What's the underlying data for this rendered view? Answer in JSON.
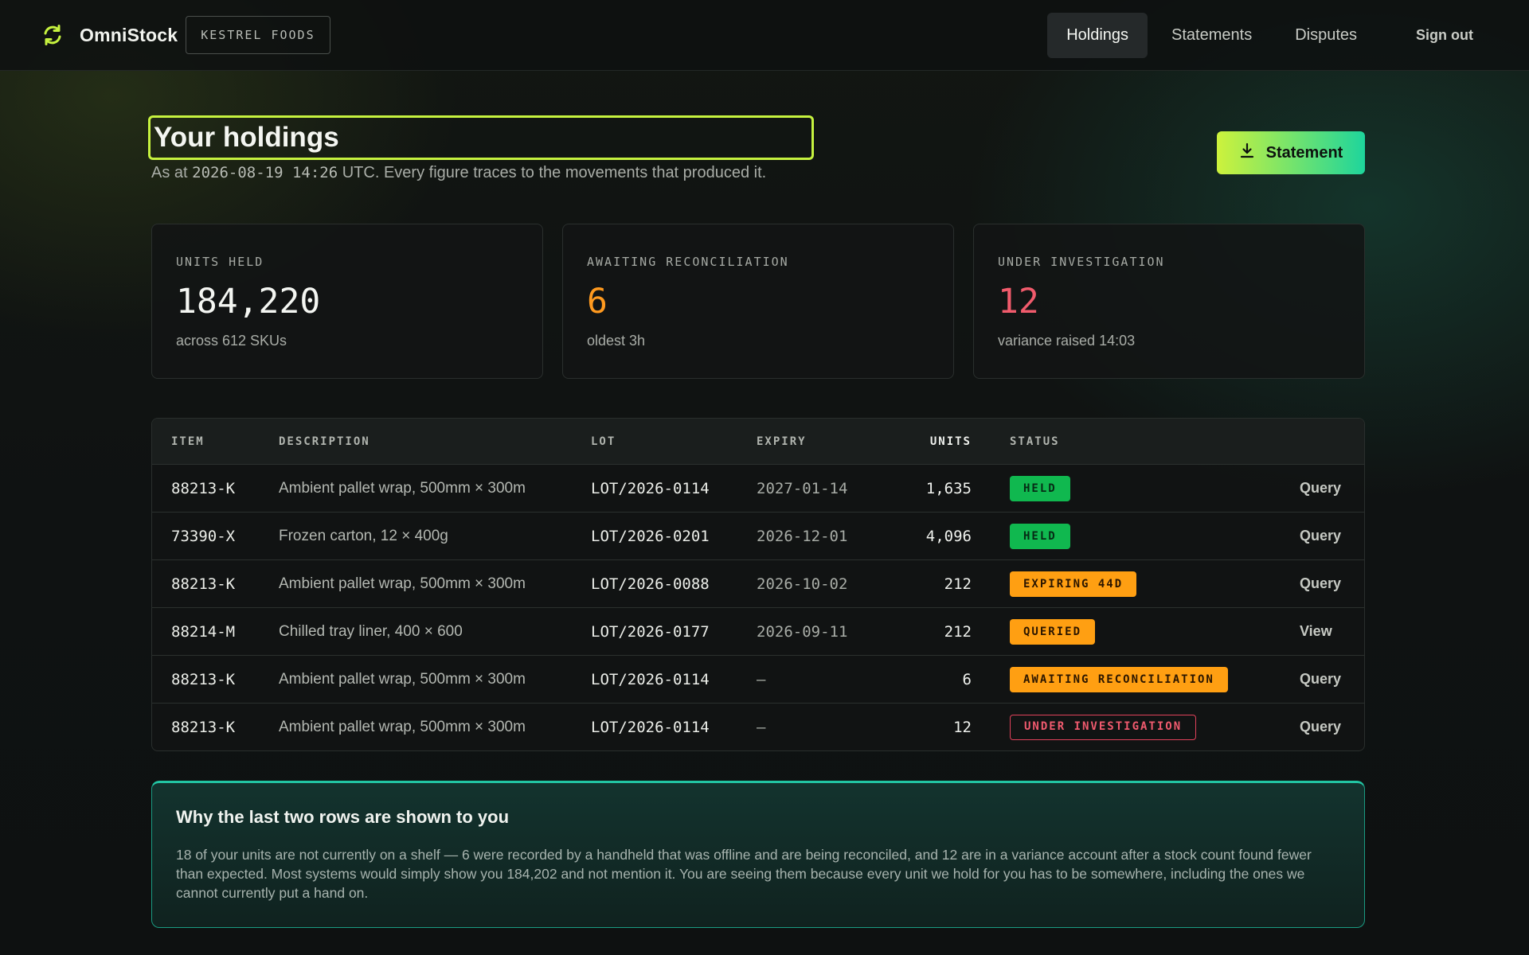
{
  "brand": {
    "name": "OmniStock",
    "tenant": "KESTREL FOODS",
    "icon": "refresh-icon",
    "accent": "#c6f23f"
  },
  "nav": {
    "items": [
      {
        "label": "Holdings",
        "active": true
      },
      {
        "label": "Statements",
        "active": false
      },
      {
        "label": "Disputes",
        "active": false
      }
    ],
    "signout": "Sign out"
  },
  "page": {
    "title": "Your holdings",
    "subtitle_prefix": "As at",
    "timestamp": "2026-08-19 14:26",
    "subtitle_suffix": "UTC. Every figure traces to the movements that produced it.",
    "statement_button": "Statement"
  },
  "stats": [
    {
      "label": "UNITS HELD",
      "value": "184,220",
      "note": "across 612 SKUs",
      "color": "#f4f6f2"
    },
    {
      "label": "AWAITING RECONCILIATION",
      "value": "6",
      "note": "oldest 3h",
      "color": "#ff9a1f"
    },
    {
      "label": "UNDER INVESTIGATION",
      "value": "12",
      "note": "variance raised 14:03",
      "color": "#f15b6c"
    }
  ],
  "table": {
    "headers": {
      "item": "ITEM",
      "description": "DESCRIPTION",
      "lot": "LOT",
      "expiry": "EXPIRY",
      "units": "UNITS",
      "status": "STATUS"
    },
    "rows": [
      {
        "item": "88213-K",
        "description": "Ambient pallet wrap, 500mm × 300m",
        "lot": "LOT/2026-0114",
        "expiry": "2027-01-14",
        "units": "1,635",
        "status": "HELD",
        "status_kind": "held",
        "action": "Query"
      },
      {
        "item": "73390-X",
        "description": "Frozen carton, 12 × 400g",
        "lot": "LOT/2026-0201",
        "expiry": "2026-12-01",
        "units": "4,096",
        "status": "HELD",
        "status_kind": "held",
        "action": "Query"
      },
      {
        "item": "88213-K",
        "description": "Ambient pallet wrap, 500mm × 300m",
        "lot": "LOT/2026-0088",
        "expiry": "2026-10-02",
        "units": "212",
        "status": "EXPIRING 44D",
        "status_kind": "warn",
        "action": "Query"
      },
      {
        "item": "88214-M",
        "description": "Chilled tray liner, 400 × 600",
        "lot": "LOT/2026-0177",
        "expiry": "2026-09-11",
        "units": "212",
        "status": "QUERIED",
        "status_kind": "warn",
        "action": "View"
      },
      {
        "item": "88213-K",
        "description": "Ambient pallet wrap, 500mm × 300m",
        "lot": "LOT/2026-0114",
        "expiry": "—",
        "units": "6",
        "status": "AWAITING RECONCILIATION",
        "status_kind": "warn",
        "action": "Query"
      },
      {
        "item": "88213-K",
        "description": "Ambient pallet wrap, 500mm × 300m",
        "lot": "LOT/2026-0114",
        "expiry": "—",
        "units": "12",
        "status": "UNDER INVESTIGATION",
        "status_kind": "danger",
        "action": "Query"
      }
    ]
  },
  "panel": {
    "title": "Why the last two rows are shown to you",
    "body": "18 of your units are not currently on a shelf — 6 were recorded by a handheld that was offline and are being reconciled, and 12 are in a variance account after a stock count found fewer than expected. Most systems would simply show you 184,202 and not mention it. You are seeing them because every unit we hold for you has to be somewhere, including the ones we cannot currently put a hand on."
  }
}
